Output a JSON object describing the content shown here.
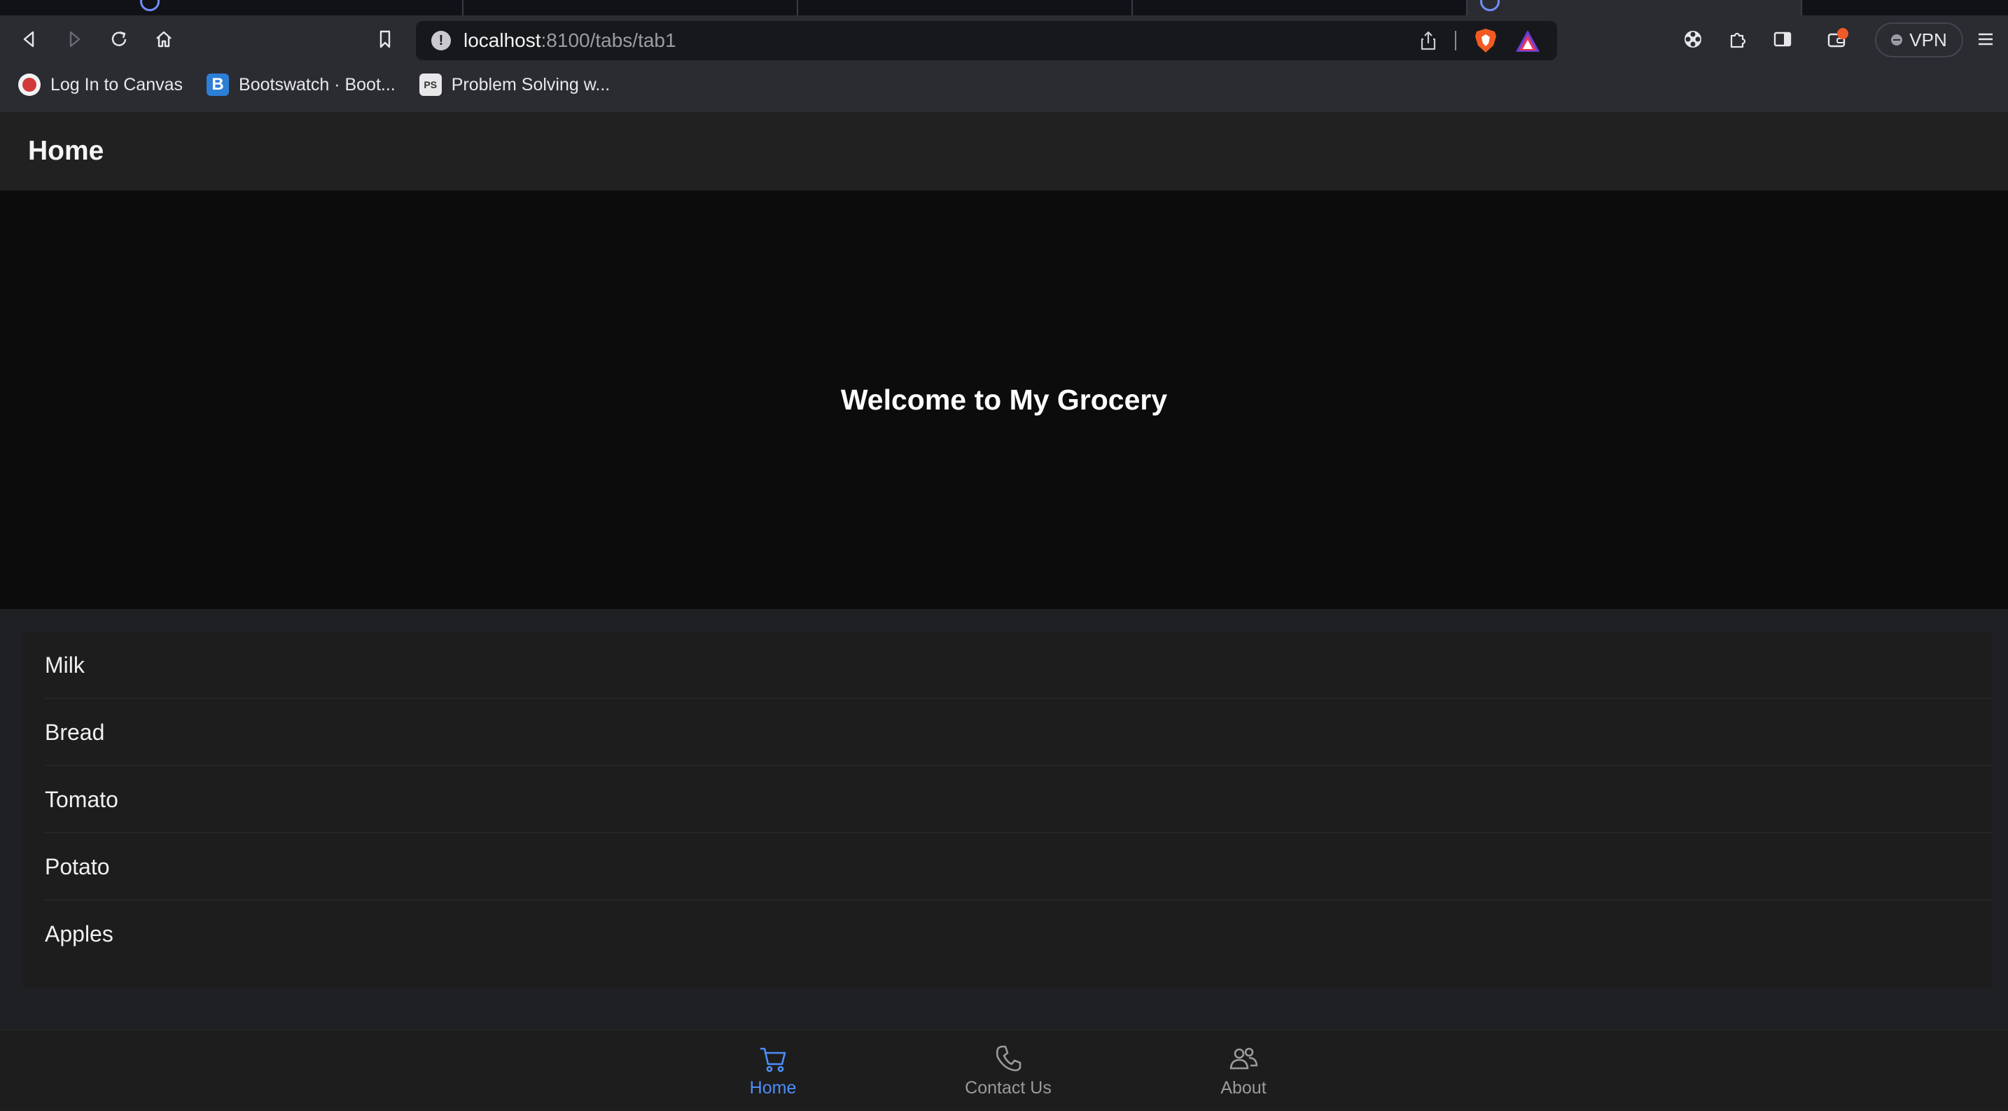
{
  "browser": {
    "url_host": "localhost",
    "url_rest": ":8100/tabs/tab1",
    "vpn_label": "VPN",
    "bookmarks": [
      {
        "label": "Log In to Canvas",
        "icon": "canvas-icon"
      },
      {
        "label": "Bootswatch · Boot...",
        "icon": "bootswatch-icon",
        "glyph": "B"
      },
      {
        "label": "Problem Solving w...",
        "icon": "problem-solving-icon",
        "glyph": "PS"
      }
    ]
  },
  "app": {
    "header_title": "Home",
    "hero_title": "Welcome to My Grocery",
    "items": [
      "Milk",
      "Bread",
      "Tomato",
      "Potato",
      "Apples"
    ],
    "tabs": [
      {
        "label": "Home",
        "icon": "cart-icon",
        "selected": true
      },
      {
        "label": "Contact Us",
        "icon": "phone-icon",
        "selected": false
      },
      {
        "label": "About",
        "icon": "people-icon",
        "selected": false
      }
    ],
    "accent_color": "#4d8df7"
  }
}
